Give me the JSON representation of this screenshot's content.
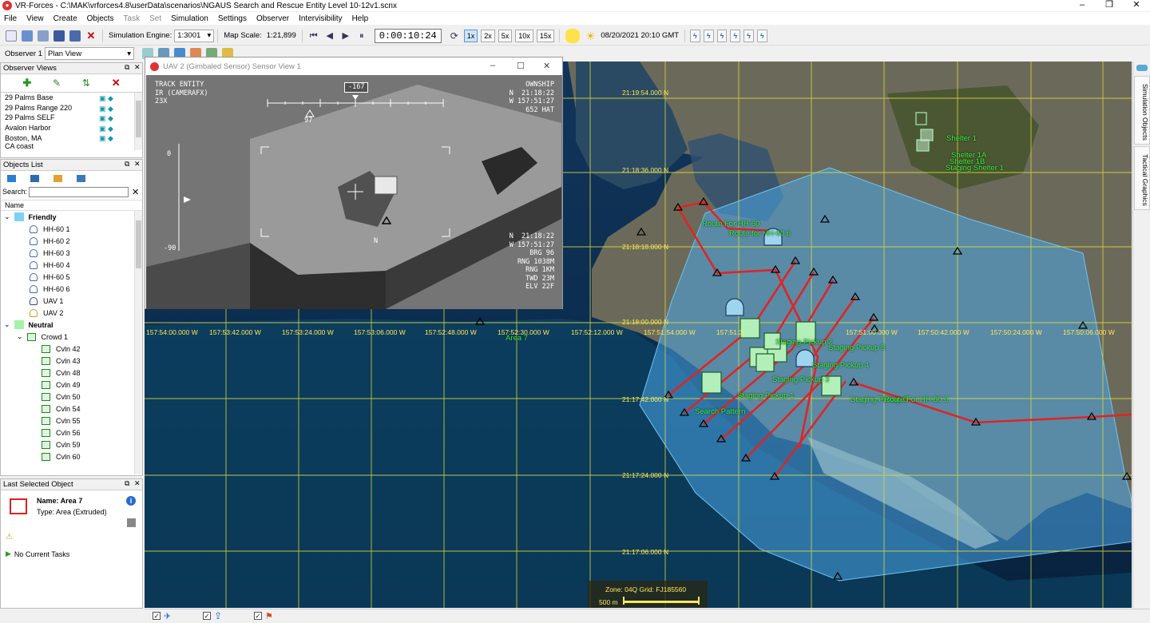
{
  "window": {
    "title": "VR-Forces - C:\\MAK\\vrforces4.8\\userData\\scenarios\\NGAUS Search and Rescue Entity Level 10-12v1.scnx",
    "minimize": "–",
    "maximize": "❐",
    "close": "✕"
  },
  "menu": [
    "File",
    "View",
    "Create",
    "Objects",
    "Task",
    "Set",
    "Simulation",
    "Settings",
    "Observer",
    "Intervisibility",
    "Help"
  ],
  "toolbar": {
    "sim_engine_label": "Simulation Engine:",
    "sim_engine_value": "1:3001",
    "map_scale_label": "Map Scale:",
    "map_scale_value": "1:21,899",
    "time": "0:00:10:24",
    "speeds": [
      "1x",
      "2x",
      "5x",
      "10x",
      "15x"
    ],
    "datetime": "08/20/2021 20:10 GMT"
  },
  "toolbar2": {
    "observer_label": "Observer 1",
    "view_value": "Plan View"
  },
  "observer_views": {
    "title": "Observer Views",
    "items": [
      "29 Palms Base",
      "29 Palms Range 220",
      "29 Palms SELF",
      "Avalon Harbor",
      "Boston, MA",
      "CA coast"
    ]
  },
  "objects_list": {
    "title": "Objects List",
    "search_label": "Search:",
    "search_value": "",
    "column_name": "Name",
    "groups": [
      {
        "label": "Friendly",
        "color": "#7fd0f5",
        "items": [
          "HH-60 1",
          "HH-60 2",
          "HH-60 3",
          "HH-60 4",
          "HH-60 5",
          "HH-60 6",
          "UAV 1",
          "UAV 2"
        ]
      },
      {
        "label": "Neutral",
        "color": "#a6f2a6",
        "subgroup": "Crowd 1",
        "items": [
          "Cvln 42",
          "Cvln 43",
          "Cvln 48",
          "Cvln 49",
          "Cvln 50",
          "Cvln 54",
          "Cvln 55",
          "Cvln 56",
          "Cvln 59",
          "Cvln 60"
        ]
      }
    ]
  },
  "last_selected": {
    "title": "Last Selected Object",
    "name": "Name: Area 7",
    "type": "Type: Area (Extruded)",
    "tasks": "No Current Tasks"
  },
  "sensor_view": {
    "title": "UAV 2 (Gimbaled Sensor) Sensor View 1",
    "top_left": "TRACK ENTITY\nIR (CAMERAFX)\n23X",
    "top_right": "OWNSHIP\nN  21:18:22\nW 157:51:27\n652 HAT",
    "bottom_right": "N  21:18:22\nW 157:51:27\nBRG 96\nRNG 1038M\nRNG 1KM\nTWD 23M\nELV 22F",
    "heading": "-167",
    "pitch_top": "0",
    "pitch_bottom": "-90",
    "heading_sub": "97",
    "north": "N"
  },
  "right_tabs": [
    "Simulation Objects",
    "Tactical Graphics"
  ],
  "map": {
    "lat_labels": [
      "21:19:54.000 N",
      "21:18:36.000 N",
      "21:18:18.000 N",
      "21:18:00.000 N",
      "21:17:42.000 N",
      "21:17:24.000 N",
      "21:17:06.000 N"
    ],
    "lon_labels": [
      "157:54:00.000 W",
      "157:53:42.000 W",
      "157:53:24.000 W",
      "157:53:06.000 W",
      "157:52:48.000 W",
      "157:52:30.000 W",
      "157:52:12.000 W",
      "157:51:54.000 W",
      "157:51:3",
      "157:51:00.000 W",
      "157:50:42.000 W",
      "157:50:24.000 W",
      "157:50:06.000 W"
    ],
    "labels": {
      "shelter1": "Shelter 1",
      "shelter1a": "Shelter 1A",
      "shelter1b": "Shelter 1B",
      "staging_shelter": "Staging Shelter 1",
      "route_hh60": "Route For HH-60",
      "route_hh60_6": "Route for HH-60 6",
      "area7": "Area 7",
      "staging_pickup5": "Staging Pickup 5",
      "staging_pickup2": "Staging Pickup 2",
      "staging_pickup4": "Staging Pickup 4",
      "staging_pickup3": "Staging Pickup 3",
      "staging_pickup1": "Staging Pickup 1",
      "search_pattern": "Search Pattern",
      "staging_pickup6": "Staging Pickup 6",
      "route_hh60_6b": "Route For HH-60 6"
    },
    "zone": "Zone: 04Q Grid: FJ185560",
    "scale": "500 m"
  }
}
